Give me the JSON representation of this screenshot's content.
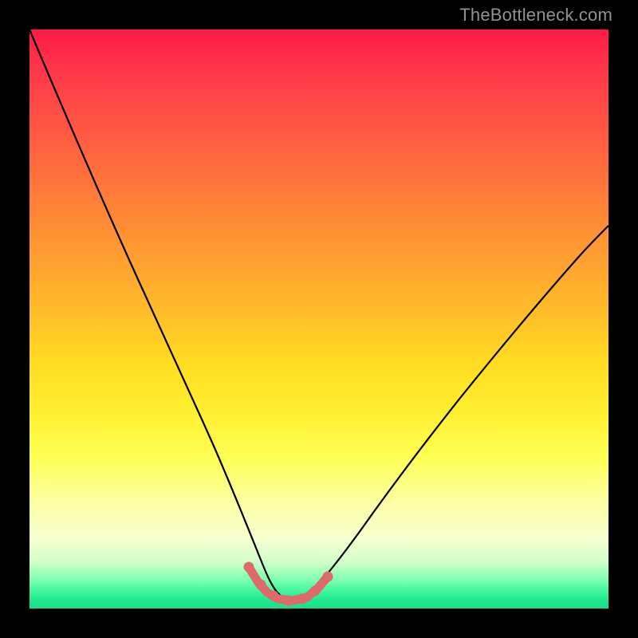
{
  "watermark": "TheBottleneck.com",
  "colors": {
    "frame": "#000000",
    "curve": "#000000",
    "bump": "#de6a6a",
    "watermark": "#92928f",
    "gradient_top": "#ff1a4a",
    "gradient_mid": "#ffee30",
    "gradient_bottom": "#18e088"
  },
  "chart_data": {
    "type": "line",
    "title": "",
    "xlabel": "",
    "ylabel": "",
    "xlim": [
      0,
      100
    ],
    "ylim": [
      0,
      100
    ],
    "x": [
      0,
      5,
      10,
      15,
      20,
      25,
      30,
      34,
      37,
      39,
      41,
      43,
      45,
      48,
      52,
      58,
      66,
      76,
      88,
      100
    ],
    "values": [
      100,
      86,
      72,
      59,
      47,
      36,
      26,
      18,
      12,
      8,
      5,
      4,
      4,
      5,
      8,
      14,
      23,
      35,
      49,
      64
    ],
    "notes": "V-shaped bottleneck curve; minimum band near x≈40–46 highlighted with salmon markers; background is vertical rainbow gradient red→yellow→green indicating bottleneck severity top-to-bottom.",
    "highlight_region": {
      "x_start": 36,
      "x_end": 50,
      "y_approx": 4
    }
  }
}
